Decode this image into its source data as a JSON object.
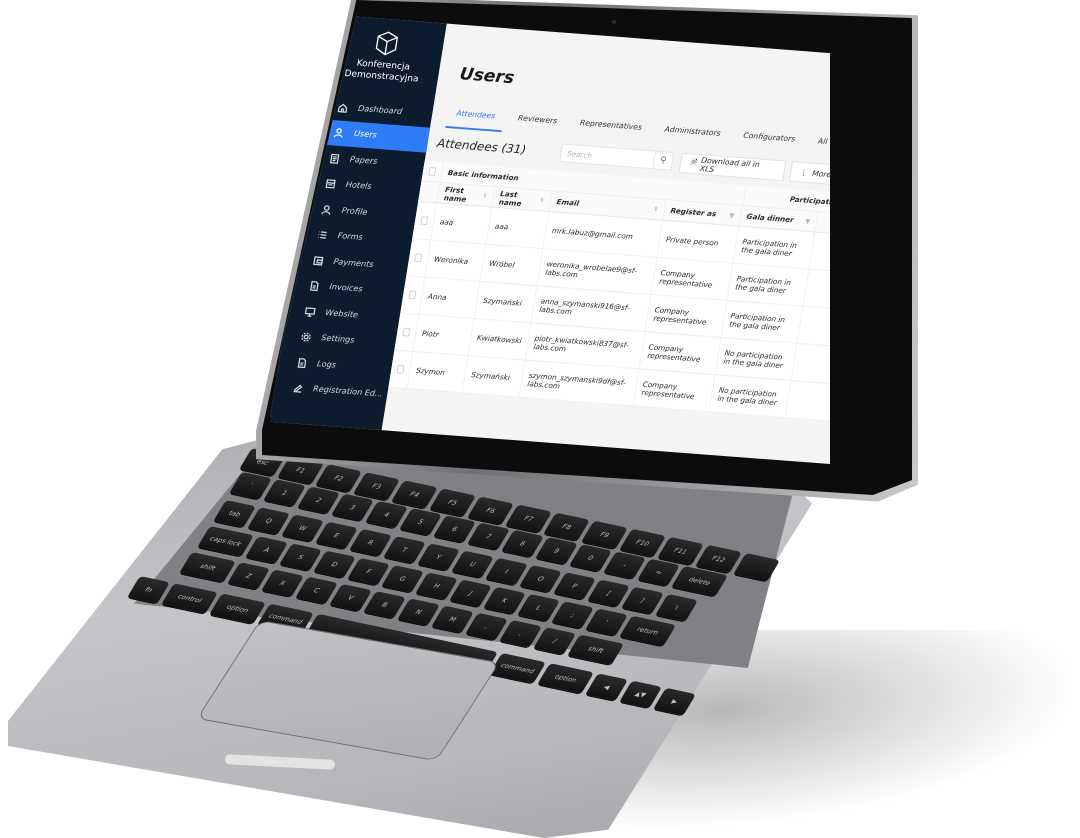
{
  "app": {
    "brand_name": "Konferencja Demonstracyjna",
    "accent_color": "#2e7cf6",
    "sidebar_color": "#0d1b2e"
  },
  "sidebar": {
    "items": [
      {
        "label": "Dashboard",
        "icon": "home-icon",
        "active": false
      },
      {
        "label": "Users",
        "icon": "users-icon",
        "active": true
      },
      {
        "label": "Papers",
        "icon": "papers-icon",
        "active": false
      },
      {
        "label": "Hotels",
        "icon": "hotel-icon",
        "active": false
      },
      {
        "label": "Profile",
        "icon": "profile-icon",
        "active": false
      },
      {
        "label": "Forms",
        "icon": "list-icon",
        "active": false
      },
      {
        "label": "Payments",
        "icon": "wallet-icon",
        "active": false
      },
      {
        "label": "Invoices",
        "icon": "invoice-icon",
        "active": false
      },
      {
        "label": "Website",
        "icon": "monitor-icon",
        "active": false
      },
      {
        "label": "Settings",
        "icon": "gear-icon",
        "active": false
      },
      {
        "label": "Logs",
        "icon": "document-icon",
        "active": false
      },
      {
        "label": "Registration Ed...",
        "icon": "edit-icon",
        "active": false
      }
    ]
  },
  "header": {
    "title": "Users",
    "language_icon": "globe-icon"
  },
  "tabs": [
    {
      "label": "Attendees",
      "active": true
    },
    {
      "label": "Reviewers",
      "active": false
    },
    {
      "label": "Representatives",
      "active": false
    },
    {
      "label": "Administrators",
      "active": false
    },
    {
      "label": "Configurators",
      "active": false
    },
    {
      "label": "All users",
      "active": false
    }
  ],
  "section": {
    "title": "Attendees (31)",
    "search_placeholder": "Search",
    "download_label": "Download all in XLS",
    "more_label": "More"
  },
  "table": {
    "groups": {
      "basic": "Basic information",
      "participation": "Participation optic"
    },
    "columns": {
      "first_name": "First name",
      "last_name": "Last name",
      "email": "Email",
      "register_as": "Register as",
      "gala_dinner": "Gala dinner"
    },
    "rows": [
      {
        "first_name": "aaa",
        "last_name": "aaa",
        "email": "mrk.labuz@gmail.com",
        "register_as": "Private person",
        "gala_dinner": "Participation in the gala diner"
      },
      {
        "first_name": "Weronika",
        "last_name": "Wróbel",
        "email": "weronika_wrobelae9@sf-labs.com",
        "register_as": "Company representative",
        "gala_dinner": "Participation in the gala diner"
      },
      {
        "first_name": "Anna",
        "last_name": "Szymański",
        "email": "anna_szymanski916@sf-labs.com",
        "register_as": "Company representative",
        "gala_dinner": "Participation in the gala diner"
      },
      {
        "first_name": "Piotr",
        "last_name": "Kwiatkowski",
        "email": "piotr_kwiatkowski837@sf-labs.com",
        "register_as": "Company representative",
        "gala_dinner": "No participation in the gala diner"
      },
      {
        "first_name": "Szymon",
        "last_name": "Szymański",
        "email": "szymon_szymanski9df@sf-labs.com",
        "register_as": "Company representative",
        "gala_dinner": "No participation in the gala diner"
      }
    ]
  },
  "keyboard": {
    "rows": [
      [
        "esc",
        "F1",
        "F2",
        "F3",
        "F4",
        "F5",
        "F6",
        "F7",
        "F8",
        "F9",
        "F10",
        "F11",
        "F12",
        ""
      ],
      [
        "`",
        "1",
        "2",
        "3",
        "4",
        "5",
        "6",
        "7",
        "8",
        "9",
        "0",
        "-",
        "=",
        "delete"
      ],
      [
        "tab",
        "Q",
        "W",
        "E",
        "R",
        "T",
        "Y",
        "U",
        "I",
        "O",
        "P",
        "[",
        "]",
        "\\"
      ],
      [
        "caps lock",
        "A",
        "S",
        "D",
        "F",
        "G",
        "H",
        "J",
        "K",
        "L",
        ";",
        "'",
        "return"
      ],
      [
        "shift",
        "Z",
        "X",
        "C",
        "V",
        "B",
        "N",
        "M",
        ",",
        ".",
        "/",
        "shift"
      ],
      [
        "fn",
        "control",
        "option",
        "command",
        "",
        "command",
        "option",
        "◀",
        "▲▼",
        "▶"
      ]
    ]
  }
}
